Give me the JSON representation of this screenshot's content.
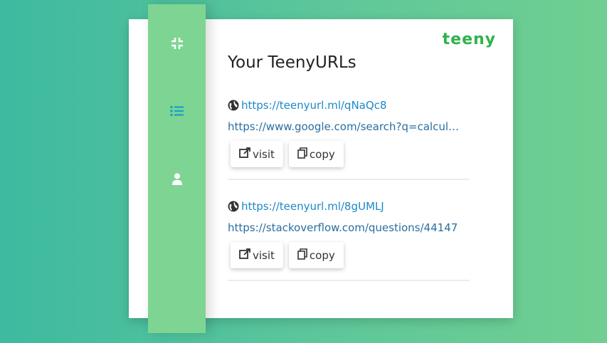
{
  "brand": {
    "name": "teeny"
  },
  "sidebar": {
    "items": [
      {
        "icon": "compress-icon",
        "color": "#ffffff"
      },
      {
        "icon": "list-icon",
        "color": "#1ba3c6"
      },
      {
        "icon": "user-icon",
        "color": "#ffffff"
      }
    ]
  },
  "page": {
    "title": "Your TeenyURLs"
  },
  "urls": [
    {
      "short_url": "https://teenyurl.ml/qNaQc8",
      "long_url": "https://www.google.com/search?q=calculator&oq=calc",
      "visit_label": "visit",
      "copy_label": "copy"
    },
    {
      "short_url": "https://teenyurl.ml/8gUMLJ",
      "long_url": "https://stackoverflow.com/questions/44147",
      "visit_label": "visit",
      "copy_label": "copy"
    }
  ],
  "colors": {
    "brand": "#2fb34a",
    "sidebar": "#7ed593",
    "link": "#1e88c8"
  }
}
